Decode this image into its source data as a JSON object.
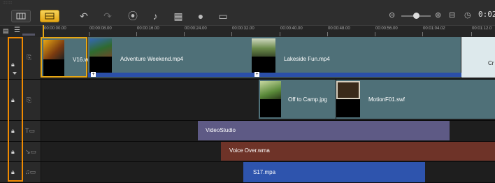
{
  "toolbar": {
    "tools": [
      "undo-icon",
      "redo-icon",
      "record-capture-icon",
      "sound-mixer-icon",
      "auto-music-icon",
      "motion-tracking-icon",
      "subtitle-editor-icon"
    ],
    "zoom_readout": "0:02:"
  },
  "ruler": {
    "ticks": [
      "00:00:00.00",
      "00:00:08.00",
      "00:00:16.00",
      "00:00:24.00",
      "00:00:32.00",
      "00:00:40.00",
      "00:00:48.00",
      "00:00:56.00",
      "00:01:04.02",
      "00:01:12.0"
    ]
  },
  "tracks": {
    "video": {
      "clips": [
        {
          "label": "V16.w"
        },
        {
          "label": "Adventure Weekend.mp4"
        },
        {
          "label": "Lakeside Fun.mp4"
        },
        {
          "label": "Cr"
        }
      ]
    },
    "overlay": {
      "clips": [
        {
          "label": "Off to Camp.jpg"
        },
        {
          "label": "MotionF01.swf"
        }
      ]
    },
    "title": {
      "clip": "VideoStudio"
    },
    "voice": {
      "clip": "Voice Over.wma"
    },
    "music": {
      "clip": "S17.mpa"
    }
  },
  "colors": {
    "accent": "#e6a614",
    "highlight": "#f08a00",
    "video_clip": "#4f7078",
    "title_clip": "#5e5a85",
    "voice_clip": "#6e3328",
    "music_clip": "#2e54ad",
    "transition_bar": "#2b4fa8"
  }
}
